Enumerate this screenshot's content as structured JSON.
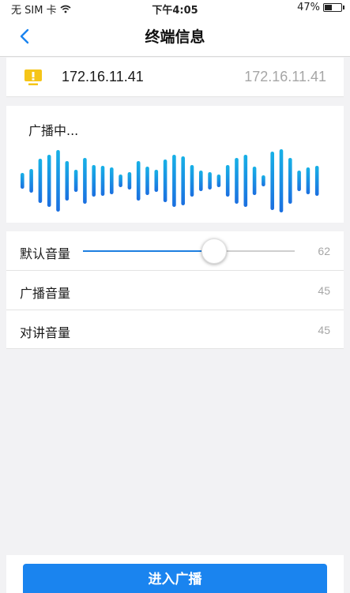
{
  "status_bar": {
    "carrier": "无 SIM 卡",
    "time": "下午4:05",
    "battery_text": "47%",
    "battery_level": 0.47
  },
  "nav": {
    "title": "终端信息"
  },
  "device": {
    "ip": "172.16.11.41",
    "ip_secondary": "172.16.11.41"
  },
  "broadcast": {
    "status_text": "广播中..."
  },
  "settings": {
    "default_volume": {
      "label": "默认音量",
      "value": "62",
      "level": 0.62
    },
    "broadcast_volume": {
      "label": "广播音量",
      "value": "45"
    },
    "intercom_volume": {
      "label": "对讲音量",
      "value": "45"
    }
  },
  "actions": {
    "enter_broadcast": "进入广播"
  },
  "colors": {
    "accent": "#1a84ef",
    "warning_icon": "#f5c518",
    "wave_top": "#17b1e6",
    "wave_bottom": "#1b6fe0"
  }
}
